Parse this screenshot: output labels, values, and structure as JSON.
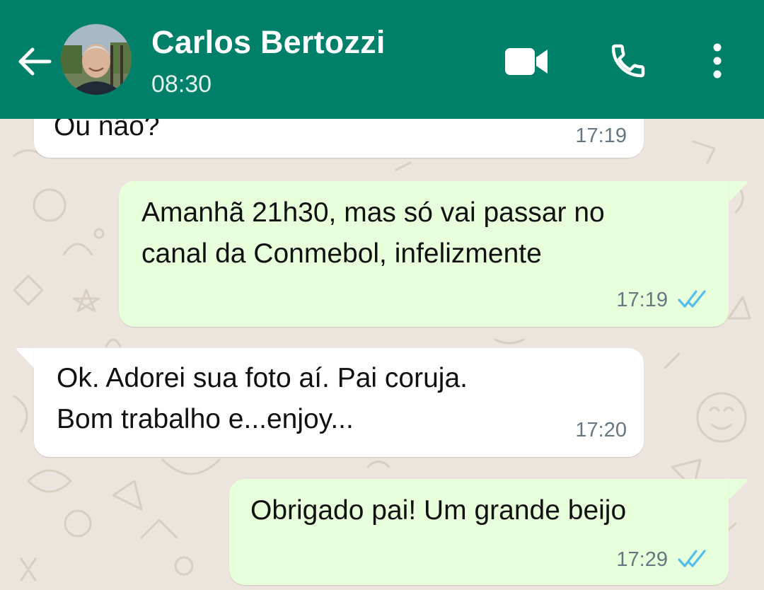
{
  "header": {
    "contact_name": "Carlos Bertozzi",
    "status": "08:30",
    "icons": {
      "back": "arrow-left-icon",
      "avatar": "contact-avatar",
      "video": "video-call-icon",
      "call": "phone-icon",
      "menu": "more-vert-icon"
    }
  },
  "colors": {
    "header_bg": "#008069",
    "chat_bg": "#ECE5DD",
    "incoming_bubble": "#FFFFFF",
    "outgoing_bubble": "#E7FFDB",
    "read_ticks": "#53BDEB",
    "time_text": "#667781"
  },
  "messages": [
    {
      "direction": "incoming",
      "lines": [
        "Ou não?"
      ],
      "time": "17:19"
    },
    {
      "direction": "outgoing",
      "lines": [
        "Amanhã 21h30, mas só vai passar no",
        "canal da Conmebol, infelizmente"
      ],
      "time": "17:19",
      "status": "read"
    },
    {
      "direction": "incoming",
      "lines": [
        "Ok. Adorei sua foto aí. Pai coruja.",
        "Bom trabalho e...enjoy..."
      ],
      "time": "17:20"
    },
    {
      "direction": "outgoing",
      "lines": [
        "Obrigado pai! Um grande beijo"
      ],
      "time": "17:29",
      "status": "read"
    }
  ]
}
